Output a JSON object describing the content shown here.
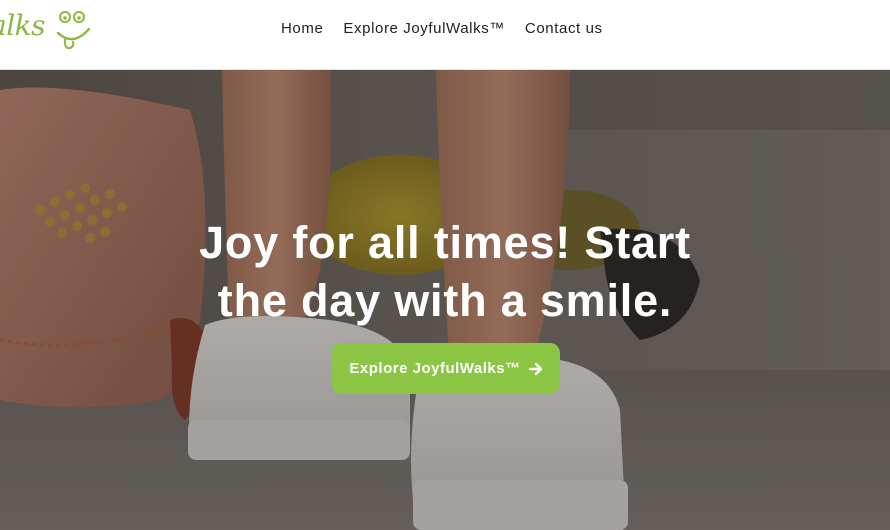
{
  "brand": {
    "logo_text": "alks",
    "logo_color": "#8ab83e",
    "logo_icon": "smiley-face-icon"
  },
  "nav": {
    "items": [
      {
        "label": "Home"
      },
      {
        "label": "Explore JoyfulWalks™"
      },
      {
        "label": "Contact us"
      }
    ]
  },
  "hero": {
    "heading": "Joy for all times! Start the day with a smile.",
    "button_label": "Explore JoyfulWalks™",
    "button_icon": "arrow-right-icon",
    "button_color": "#8cc443",
    "image_description_icon": "hero-photo"
  }
}
